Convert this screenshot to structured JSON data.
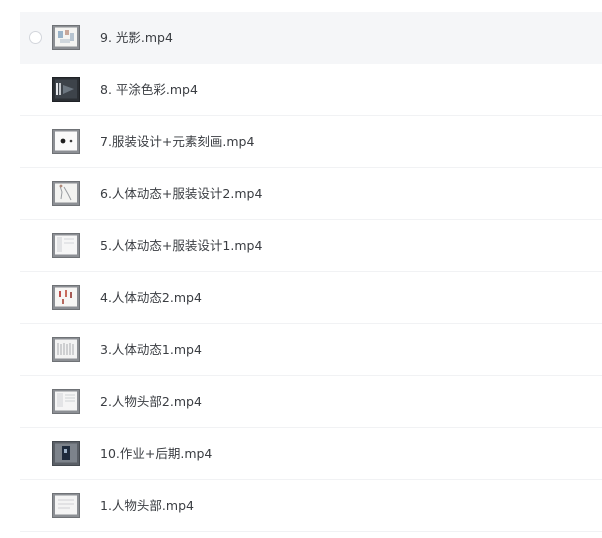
{
  "files": [
    {
      "name": "9. 光影.mp4",
      "thumb": "sketch-thumbnail-icon",
      "hovered": true
    },
    {
      "name": "8. 平涂色彩.mp4",
      "thumb": "dark-video-thumbnail-icon",
      "hovered": false
    },
    {
      "name": "7.服装设计+元素刻画.mp4",
      "thumb": "sketch-thumbnail-icon",
      "hovered": false
    },
    {
      "name": "6.人体动态+服装设计2.mp4",
      "thumb": "sketch-thumbnail-icon",
      "hovered": false
    },
    {
      "name": "5.人体动态+服装设计1.mp4",
      "thumb": "sketch-thumbnail-icon",
      "hovered": false
    },
    {
      "name": "4.人体动态2.mp4",
      "thumb": "sketch-thumbnail-icon",
      "hovered": false
    },
    {
      "name": "3.人体动态1.mp4",
      "thumb": "sketch-thumbnail-icon",
      "hovered": false
    },
    {
      "name": "2.人物头部2.mp4",
      "thumb": "sketch-thumbnail-icon",
      "hovered": false
    },
    {
      "name": "10.作业+后期.mp4",
      "thumb": "dark-video-thumbnail-icon",
      "hovered": false
    },
    {
      "name": "1.人物头部.mp4",
      "thumb": "sketch-thumbnail-icon",
      "hovered": false
    }
  ],
  "colors": {
    "row_hover_bg": "#f5f6f8",
    "row_divider": "#f1f2f4",
    "text": "#3a3d42"
  }
}
